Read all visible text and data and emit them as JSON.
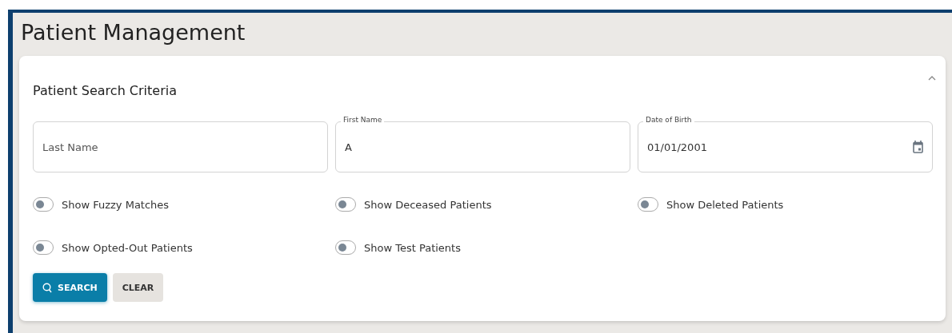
{
  "page": {
    "title": "Patient Management"
  },
  "panel": {
    "title": "Patient Search Criteria",
    "expanded": true
  },
  "fields": [
    {
      "kind": "text",
      "placeholder": "Last Name"
    },
    {
      "kind": "text",
      "label": "First Name",
      "value": "A"
    },
    {
      "kind": "date",
      "label": "Date of Birth",
      "value": "01/01/2001"
    }
  ],
  "toggles": [
    {
      "label": "Show Fuzzy Matches",
      "on": false
    },
    {
      "label": "Show Deceased Patients",
      "on": false
    },
    {
      "label": "Show Deleted Patients",
      "on": false
    },
    {
      "label": "Show Opted-Out Patients",
      "on": false
    },
    {
      "label": "Show Test Patients",
      "on": false
    }
  ],
  "buttons": [
    {
      "kind": "primary",
      "label": "SEARCH"
    },
    {
      "kind": "secondary",
      "label": "CLEAR"
    }
  ]
}
